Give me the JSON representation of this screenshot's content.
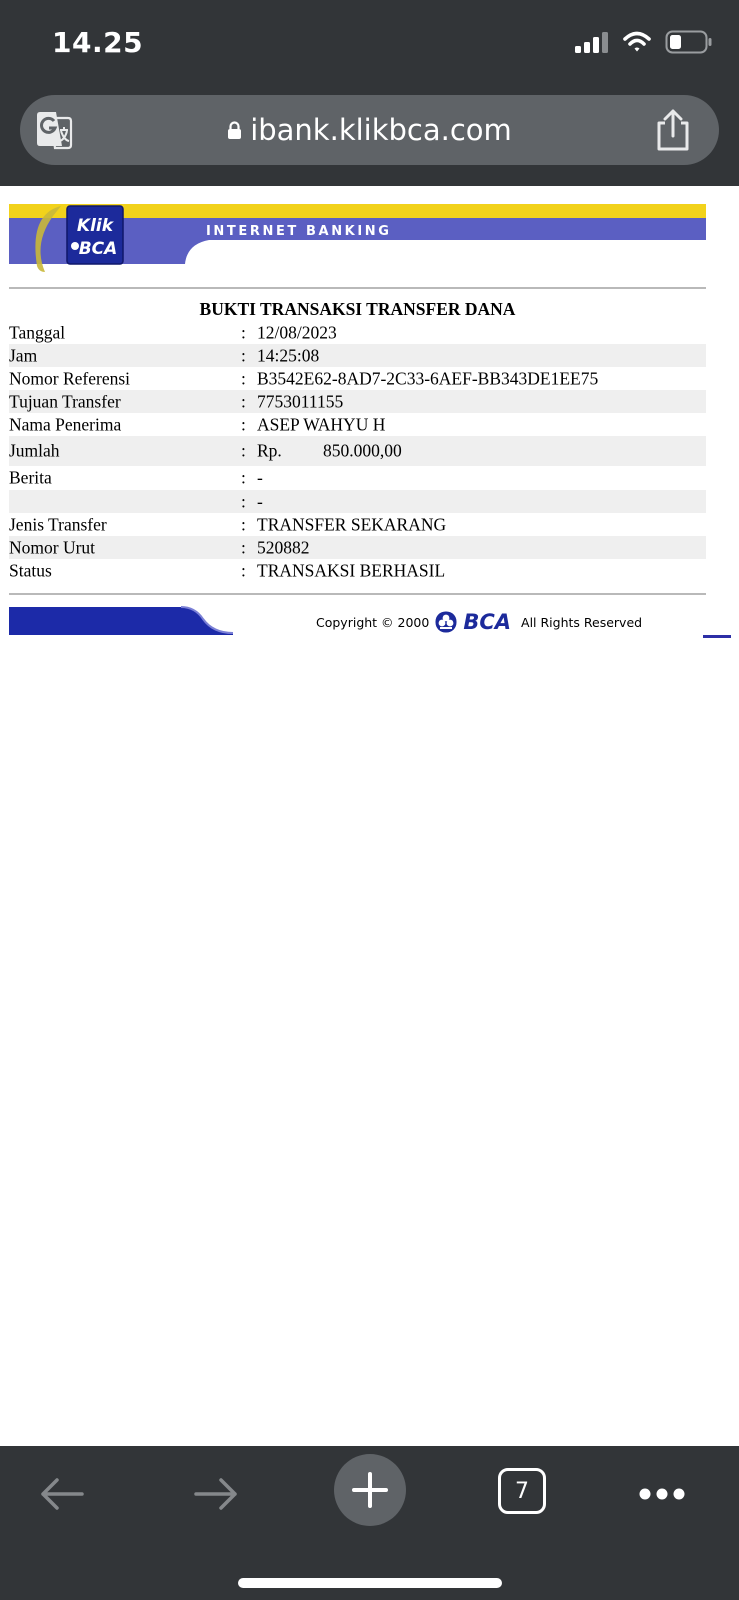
{
  "status_bar": {
    "time": "14.25",
    "icons": [
      "cellular-signal-icon",
      "wifi-icon",
      "battery-icon"
    ]
  },
  "browser": {
    "url": "ibank.klikbca.com",
    "icons": [
      "translate-icon",
      "lock-icon",
      "share-icon"
    ],
    "toolbar": {
      "tab_count": "7",
      "icons": [
        "back-arrow-icon",
        "forward-arrow-icon",
        "plus-icon",
        "tabs-icon",
        "more-icon"
      ]
    }
  },
  "header": {
    "logo_text_top": "Klik",
    "logo_text_bottom": "BCA",
    "banner_text": "INTERNET BANKING",
    "colors": {
      "yellow": "#f2d21b",
      "blue": "#5b5fc2",
      "navy": "#1c2a9b"
    }
  },
  "receipt": {
    "title": "BUKTI TRANSAKSI TRANSFER DANA",
    "colon": ":",
    "rows": [
      {
        "label": "Tanggal",
        "value": "12/08/2023"
      },
      {
        "label": "Jam",
        "value": "14:25:08"
      },
      {
        "label": "Nomor Referensi",
        "value": "B3542E62-8AD7-2C33-6AEF-BB343DE1EE75"
      },
      {
        "label": "Tujuan Transfer",
        "value": "7753011155"
      },
      {
        "label": "Nama Penerima",
        "value": "ASEP WAHYU H"
      },
      {
        "label": "Jumlah",
        "value": "Rp.",
        "amount": "850.000,00"
      },
      {
        "label": "Berita",
        "value": "-"
      },
      {
        "label": "",
        "value": "-"
      },
      {
        "label": "Jenis Transfer",
        "value": "TRANSFER SEKARANG"
      },
      {
        "label": "Nomor Urut",
        "value": "520882"
      },
      {
        "label": "Status",
        "value": "TRANSAKSI BERHASIL"
      }
    ]
  },
  "footer": {
    "copyright_text": "Copyright © 2000",
    "brand": "BCA",
    "rights": "All Rights Reserved"
  }
}
